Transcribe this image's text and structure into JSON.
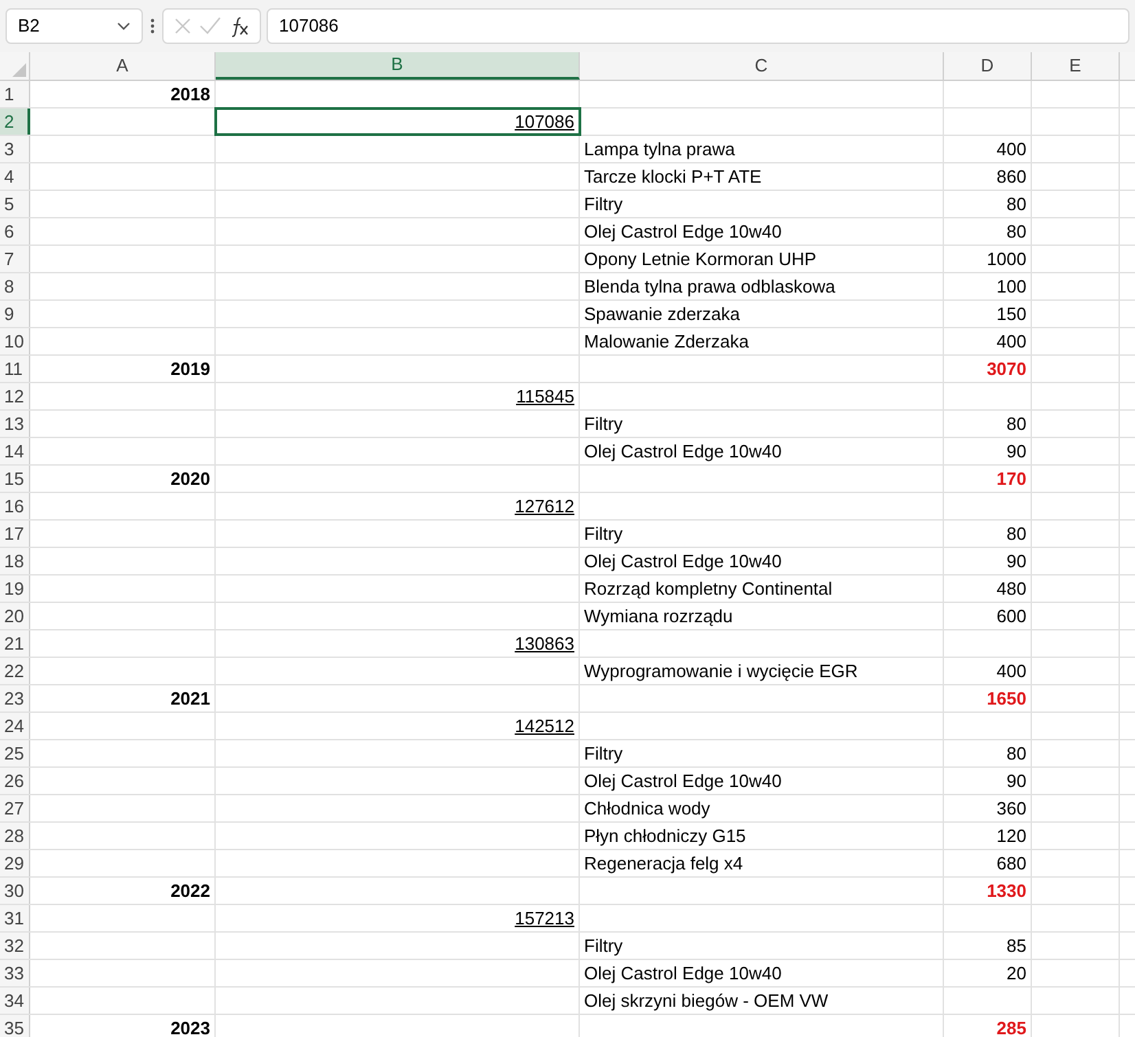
{
  "formula_bar": {
    "name_box": "B2",
    "formula": "107086"
  },
  "columns": [
    {
      "label": "A",
      "selected": false
    },
    {
      "label": "B",
      "selected": true
    },
    {
      "label": "C",
      "selected": false
    },
    {
      "label": "D",
      "selected": false
    },
    {
      "label": "E",
      "selected": false
    }
  ],
  "rows": [
    {
      "number": "1",
      "a": "2018",
      "selected": false
    },
    {
      "number": "2",
      "b": "107086",
      "selected": true
    },
    {
      "number": "3",
      "c": "Lampa tylna prawa",
      "d": "400",
      "selected": false
    },
    {
      "number": "4",
      "c": "Tarcze klocki P+T ATE",
      "d": "860",
      "selected": false
    },
    {
      "number": "5",
      "c": "Filtry",
      "d": "80",
      "selected": false
    },
    {
      "number": "6",
      "c": "Olej Castrol Edge 10w40",
      "d": "80",
      "selected": false
    },
    {
      "number": "7",
      "c": "Opony Letnie Kormoran UHP",
      "d": "1000",
      "selected": false
    },
    {
      "number": "8",
      "c": "Blenda tylna prawa odblaskowa",
      "d": "100",
      "selected": false
    },
    {
      "number": "9",
      "c": "Spawanie zderzaka",
      "d": "150",
      "selected": false
    },
    {
      "number": "10",
      "c": "Malowanie Zderzaka",
      "d": "400",
      "selected": false
    },
    {
      "number": "11",
      "a": "2019",
      "d": "3070",
      "total": true,
      "selected": false
    },
    {
      "number": "12",
      "b": "115845",
      "selected": false
    },
    {
      "number": "13",
      "c": "Filtry",
      "d": "80",
      "selected": false
    },
    {
      "number": "14",
      "c": "Olej Castrol Edge 10w40",
      "d": "90",
      "selected": false
    },
    {
      "number": "15",
      "a": "2020",
      "d": "170",
      "total": true,
      "selected": false
    },
    {
      "number": "16",
      "b": "127612",
      "selected": false
    },
    {
      "number": "17",
      "c": "Filtry",
      "d": "80",
      "selected": false
    },
    {
      "number": "18",
      "c": "Olej Castrol Edge 10w40",
      "d": "90",
      "selected": false
    },
    {
      "number": "19",
      "c": "Rozrząd kompletny Continental",
      "d": "480",
      "selected": false
    },
    {
      "number": "20",
      "c": "Wymiana rozrządu",
      "d": "600",
      "selected": false
    },
    {
      "number": "21",
      "b": "130863",
      "selected": false
    },
    {
      "number": "22",
      "c": "Wyprogramowanie i wycięcie EGR",
      "d": "400",
      "selected": false
    },
    {
      "number": "23",
      "a": "2021",
      "d": "1650",
      "total": true,
      "selected": false
    },
    {
      "number": "24",
      "b": "142512",
      "selected": false
    },
    {
      "number": "25",
      "c": "Filtry",
      "d": "80",
      "selected": false
    },
    {
      "number": "26",
      "c": "Olej Castrol Edge 10w40",
      "d": "90",
      "selected": false
    },
    {
      "number": "27",
      "c": "Chłodnica wody",
      "d": "360",
      "selected": false
    },
    {
      "number": "28",
      "c": "Płyn chłodniczy G15",
      "d": "120",
      "selected": false
    },
    {
      "number": "29",
      "c": "Regeneracja felg x4",
      "d": "680",
      "selected": false
    },
    {
      "number": "30",
      "a": "2022",
      "d": "1330",
      "total": true,
      "selected": false
    },
    {
      "number": "31",
      "b": "157213",
      "selected": false
    },
    {
      "number": "32",
      "c": "Filtry",
      "d": "85",
      "selected": false
    },
    {
      "number": "33",
      "c": "Olej Castrol Edge 10w40",
      "d": "20",
      "selected": false
    },
    {
      "number": "34",
      "c": "Olej skrzyni biegów - OEM VW",
      "selected": false
    },
    {
      "number": "35",
      "a": "2023",
      "d": "285",
      "total": true,
      "selected": false
    }
  ]
}
